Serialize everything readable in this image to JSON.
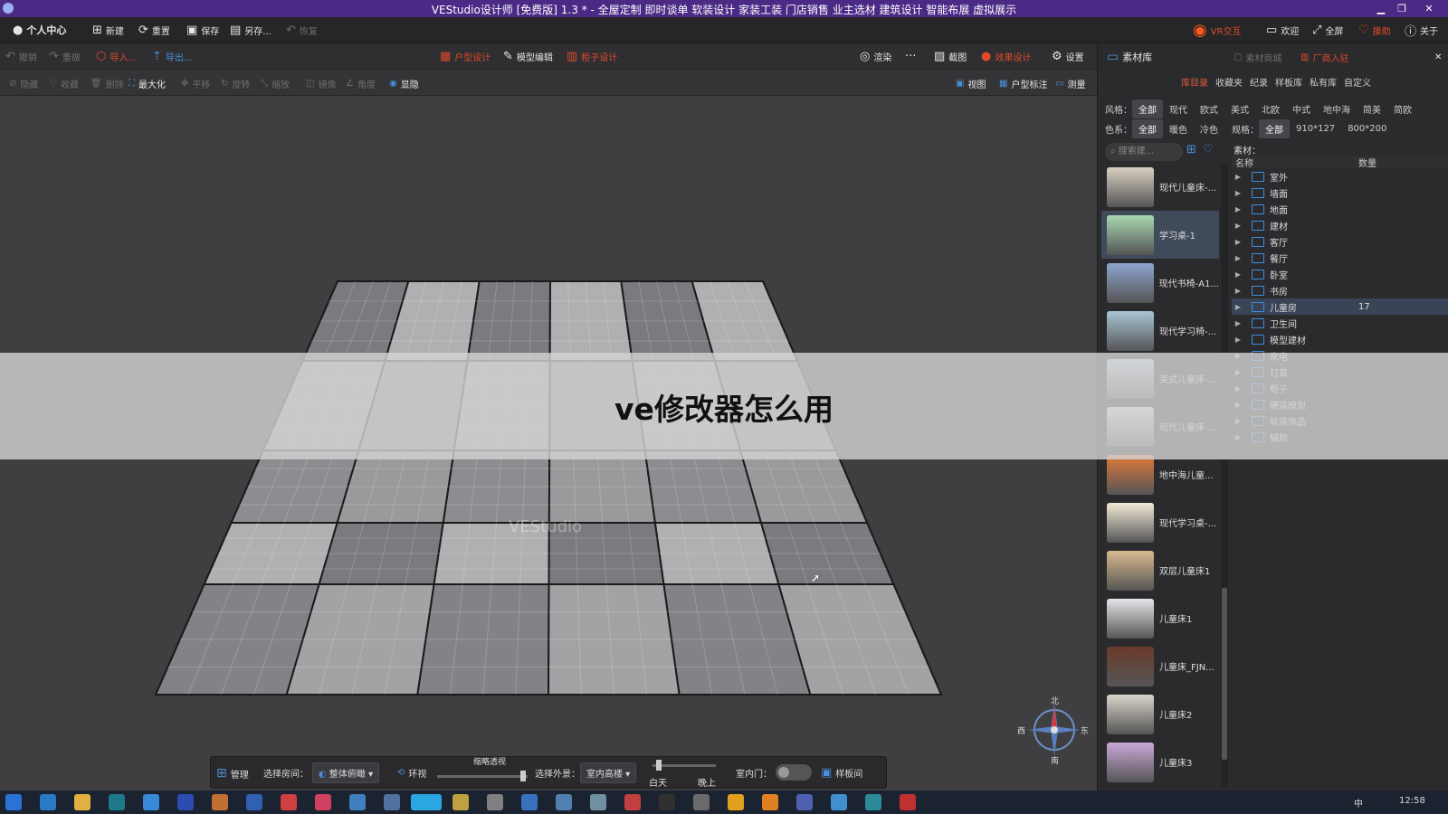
{
  "window": {
    "title": "VEStudio设计师 [免费版] 1.3 * - 全屋定制 即时谈单 软装设计 家装工装 门店销售 业主选材 建筑设计 智能布展 虚拟展示",
    "controls": {
      "minimize": "▁",
      "restore": "❐",
      "close": "✕"
    }
  },
  "menubar": {
    "user": "个人中心",
    "new": "新建",
    "reset": "重置",
    "save": "保存",
    "save_as": "另存...",
    "restore": "恢复",
    "vr": "VR交互",
    "welcome": "欢迎",
    "fullscreen": "全屏",
    "support": "援助",
    "about": "关于"
  },
  "toolbar2": {
    "undo": "撤销",
    "redo": "重做",
    "import": "导入...",
    "export": "导出...",
    "floorplan": "户型设计",
    "model_edit": "模型编辑",
    "cabinet": "柜子设计",
    "render": "渲染",
    "more": "···",
    "screenshot": "截图",
    "effect_design": "效果设计",
    "settings": "设置"
  },
  "toolbar3": {
    "hide": "隐藏",
    "favorite": "收藏",
    "delete": "删除",
    "maximize": "最大化",
    "move": "平移",
    "rotate": "旋转",
    "scale": "缩放",
    "mirror": "镜像",
    "angle": "角度",
    "show": "显隐",
    "view": "视图",
    "floor_mark": "户型标注",
    "measure": "测量"
  },
  "overlay_title": "ve修改器怎么用",
  "viewport_watermark": "VEStudio",
  "bottombar": {
    "manage": "管理",
    "select_room_label": "选择房间：",
    "room_value": "整体俯瞰",
    "orbit": "环视",
    "slider_label": "缩略透视",
    "exterior_label": "选择外景：",
    "exterior_value": "室内高楼",
    "day": "白天",
    "night": "晚上",
    "indoor_door_label": "室内门：",
    "template_room": "样板间"
  },
  "right_panel": {
    "title": "素材库",
    "shop": "素材商城",
    "vendor": "厂商入驻",
    "tabs": [
      "库目录",
      "收藏夹",
      "纪录",
      "样板库",
      "私有库",
      "自定义"
    ],
    "style_label": "风格：",
    "styles": [
      "全部",
      "现代",
      "欧式",
      "美式",
      "北欧",
      "中式",
      "地中海",
      "简美",
      "简欧"
    ],
    "color_label": "色系：",
    "colors": [
      "全部",
      "暖色",
      "冷色"
    ],
    "spec_label": "规格：",
    "specs": [
      "全部",
      "910*127",
      "800*200"
    ],
    "search_placeholder": "搜索建...",
    "material_label": "素材：",
    "columns": {
      "name": "名称",
      "count": "数量"
    },
    "thumbnails": [
      {
        "label": "现代儿童床-...",
        "color": "#d9d0c2"
      },
      {
        "label": "学习桌-1",
        "color": "#a7d8b0",
        "selected": true
      },
      {
        "label": "现代书椅-A1...",
        "color": "#8ea4cf"
      },
      {
        "label": "现代学习椅-...",
        "color": "#a8c6d6"
      },
      {
        "label": "美式儿童床-...",
        "color": "#cfe0f0"
      },
      {
        "label": "现代儿童床-...",
        "color": "#ece8dc"
      },
      {
        "label": "地中海儿童...",
        "color": "#e07a3a"
      },
      {
        "label": "现代学习桌-...",
        "color": "#f2ead6"
      },
      {
        "label": "双层儿童床1",
        "color": "#d8b98e"
      },
      {
        "label": "儿童床1",
        "color": "#e6e6ea"
      },
      {
        "label": "儿童床_FJN...",
        "color": "#6a3a2a"
      },
      {
        "label": "儿童床2",
        "color": "#d9d4ca"
      },
      {
        "label": "儿童床3",
        "color": "#c9a8d8"
      }
    ],
    "tree": [
      {
        "name": "室外",
        "count": ""
      },
      {
        "name": "墙面",
        "count": ""
      },
      {
        "name": "地面",
        "count": ""
      },
      {
        "name": "建材",
        "count": ""
      },
      {
        "name": "客厅",
        "count": ""
      },
      {
        "name": "餐厅",
        "count": ""
      },
      {
        "name": "卧室",
        "count": ""
      },
      {
        "name": "书房",
        "count": ""
      },
      {
        "name": "儿童房",
        "count": "17",
        "selected": true
      },
      {
        "name": "卫生间",
        "count": ""
      },
      {
        "name": "模型建材",
        "count": ""
      },
      {
        "name": "家电",
        "count": ""
      },
      {
        "name": "灯具",
        "count": ""
      },
      {
        "name": "柜子",
        "count": ""
      },
      {
        "name": "硬装模型",
        "count": ""
      },
      {
        "name": "软装饰品",
        "count": ""
      },
      {
        "name": "辅助",
        "count": ""
      }
    ]
  },
  "compass": {
    "north": "北",
    "south": "南",
    "east": "东",
    "west": "西"
  },
  "taskbar": {
    "time": "12:58",
    "ime": "中",
    "icons": [
      "start-icon",
      "browser-icon",
      "folder-icon",
      "terminal-icon",
      "chrome-icon",
      "photoshop-icon",
      "app-icon",
      "app-icon",
      "app-icon",
      "app-icon",
      "app-icon",
      "app-icon",
      "vestudio-icon",
      "app-icon",
      "app-icon",
      "app-icon",
      "app-icon",
      "app-icon",
      "app-icon",
      "app-icon",
      "app-icon",
      "app-icon",
      "illustrator-icon",
      "app-icon",
      "app-icon",
      "app-icon",
      "app-icon"
    ]
  },
  "colors": {
    "titlebar": "#4b2a86",
    "accent": "#e3573a",
    "selection": "#394556",
    "folder": "#3d8fdc"
  }
}
